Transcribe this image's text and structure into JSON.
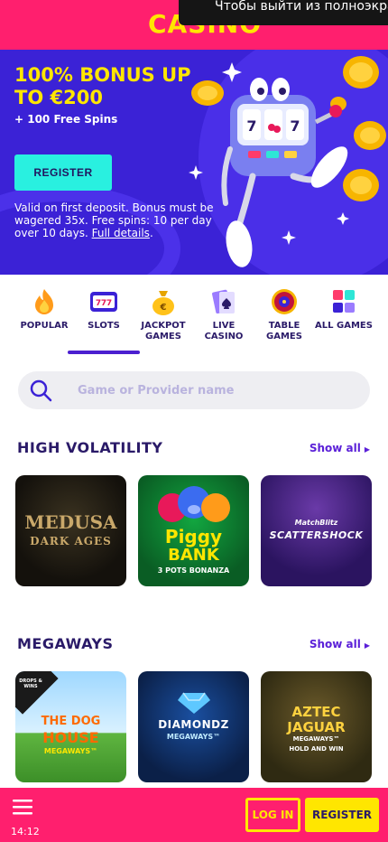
{
  "header": {
    "logo_text": "CASINO",
    "fullscreen_notice": "Чтобы выйти из полноэкран"
  },
  "banner": {
    "title": "100% BONUS UP TO €200",
    "subtitle": "+ 100 Free Spins",
    "register_label": "REGISTER",
    "terms": "Valid on first deposit. Bonus must be wagered 35x. Free spins: 10 per day over 10 days.",
    "terms_link": "Full details",
    "terms_end": "."
  },
  "tabs": [
    {
      "label": "POPULAR",
      "icon": "flame-icon"
    },
    {
      "label": "SLOTS",
      "icon": "slot-machine-icon",
      "active": true
    },
    {
      "label": "JACKPOT GAMES",
      "icon": "money-bag-icon"
    },
    {
      "label": "LIVE CASINO",
      "icon": "playing-cards-icon"
    },
    {
      "label": "TABLE GAMES",
      "icon": "roulette-icon"
    },
    {
      "label": "ALL GAMES",
      "icon": "grid-icon"
    }
  ],
  "search": {
    "placeholder": "Game or Provider name"
  },
  "sections": [
    {
      "title": "HIGH VOLATILITY",
      "show_all": "Show all",
      "games": [
        {
          "line1": "MEDUSA",
          "line2": "DARK AGES"
        },
        {
          "line1": "Piggy",
          "line2": "BANK",
          "line3": "3 POTS BONANZA"
        },
        {
          "line1": "MatchBlitz",
          "line2": "SCATTERSHOCK"
        }
      ]
    },
    {
      "title": "MEGAWAYS",
      "show_all": "Show all",
      "games": [
        {
          "badge": "DROPS & WINS",
          "line1": "THE DOG",
          "line2": "HOUSE",
          "line3": "MEGAWAYS™"
        },
        {
          "line1": "DIAMONDZ",
          "line2": "MEGAWAYS™"
        },
        {
          "line1": "AZTEC",
          "line2": "JAGUAR",
          "line3": "MEGAWAYS™",
          "line4": "HOLD AND WIN"
        }
      ]
    }
  ],
  "footer": {
    "time": "14:12",
    "login_label": "LOG IN",
    "register_label": "REGISTER"
  },
  "colors": {
    "brand_pink": "#ff1f6e",
    "brand_yellow": "#ffe600",
    "banner_blue": "#3b22d6",
    "accent_cyan": "#29f0e0",
    "text_navy": "#2a1a68",
    "link_purple": "#5b20d8"
  }
}
